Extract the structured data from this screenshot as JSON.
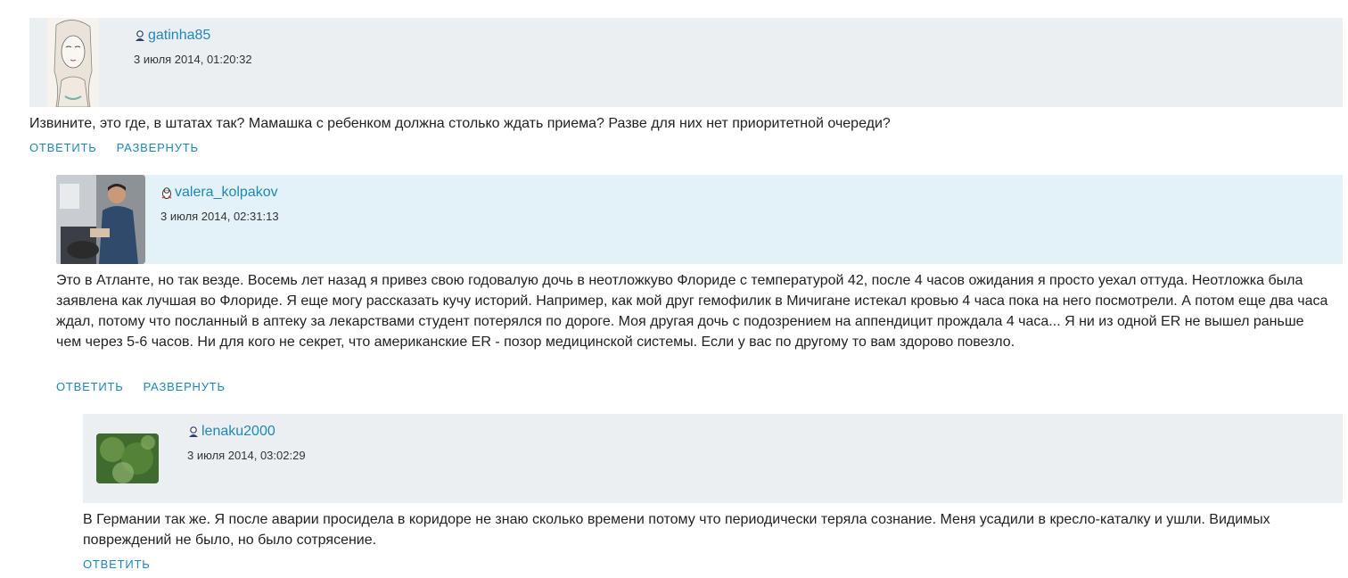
{
  "comments": [
    {
      "username": "gatinha85",
      "date": "3 июля 2014, 01:20:32",
      "text": "Извините, это где, в штатах так? Мамашка с ребенком должна столько ждать приема? Разве для них нет приоритетной очереди?",
      "actions": [
        "ОТВЕТИТЬ",
        "РАЗВЕРНУТЬ"
      ],
      "icon": "female-user-icon"
    },
    {
      "username": "valera_kolpakov",
      "date": "3 июля 2014, 02:31:13",
      "text": "Это в Атланте, но так везде. Восемь лет назад я привез свою годовалую дочь в неотложкуво Флориде с температурой 42, после 4 часов ожидания я просто уехал оттуда. Неотложка была заявлена как лучшая во Флориде. Я еще могу рассказать кучу историй. Например, как мой друг гемофилик в Мичигане истекал кровью 4 часа пока на него посмотрели. А потом еще два часа ждал, потому что посланный в аптеку за лекарствами студент потерялся по дороге. Моя другая дочь с подозрением на аппендицит прождала 4 часа... Я ни из одной ER не вышел раньше чем через 5-6 часов. Ни для кого не секрет, что американские ER - позор медицинской системы. Если у вас по другому то вам здорово повезло.",
      "actions": [
        "ОТВЕТИТЬ",
        "РАЗВЕРНУТЬ"
      ],
      "icon": "penguin-user-icon"
    },
    {
      "username": "lenaku2000",
      "date": "3 июля 2014, 03:02:29",
      "text": "В Германии так же. Я после аварии просидела в коридоре не знаю сколько времени потому что периодически теряла сознание. Меня усадили в кресло-каталку и ушли. Видимых повреждений не было, но было сотрясение.",
      "actions": [
        "ОТВЕТИТЬ"
      ],
      "icon": "female-user-icon"
    }
  ],
  "colors": {
    "link": "#1f87ba",
    "header_gray": "#eceff1",
    "header_blue": "#e3f1f8"
  }
}
